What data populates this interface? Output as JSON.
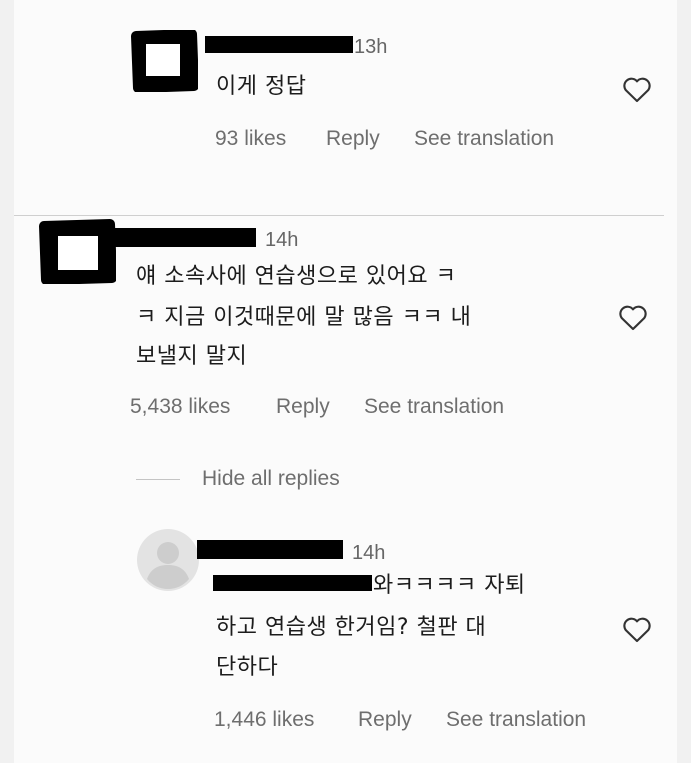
{
  "comments": [
    {
      "time": "13h",
      "text_lines": [
        "이게 정답"
      ],
      "likes": "93 likes",
      "reply_label": "Reply",
      "translate_label": "See translation",
      "liked": false
    },
    {
      "time": "14h",
      "text_lines": [
        "얘 소속사에 연습생으로 있어요 ㅋ",
        "ㅋ 지금 이것때문에 말 많음 ㅋㅋ 내",
        "보낼지 말지"
      ],
      "likes": "5,438 likes",
      "reply_label": "Reply",
      "translate_label": "See translation",
      "liked": false
    }
  ],
  "replies_toggle": "Hide all replies",
  "reply": {
    "time": "14h",
    "text_lines": [
      "와ㅋㅋㅋㅋ 자퇴",
      "하고 연습생 한거임? 철판 대",
      "단하다"
    ],
    "likes": "1,446 likes",
    "reply_label": "Reply",
    "translate_label": "See translation",
    "liked": false
  },
  "icons": {
    "like": "heart-outline-icon",
    "default_avatar": "default-avatar-icon"
  },
  "colors": {
    "background": "#fbfbfb",
    "text": "#1c1c1c",
    "secondary_text": "#6e6e6e",
    "redaction": "#000000"
  }
}
